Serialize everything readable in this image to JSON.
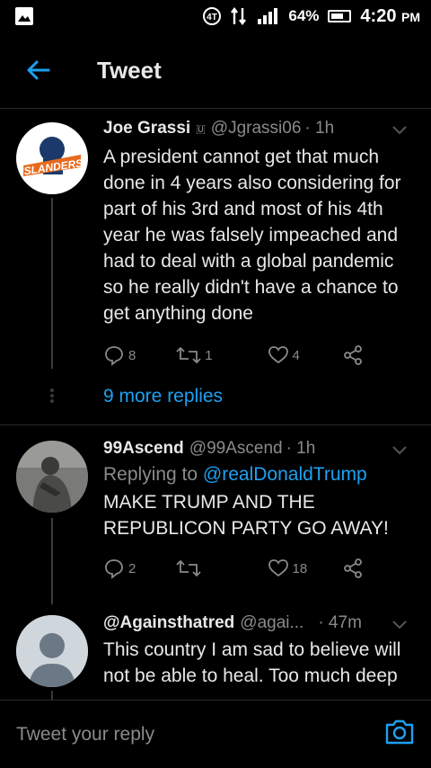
{
  "status_bar": {
    "battery": "64%",
    "time": "4:20",
    "ampm": "PM"
  },
  "app_bar": {
    "title": "Tweet"
  },
  "tweets": [
    {
      "name": "Joe Grassi",
      "badge": "🇺",
      "handle": "@Jgrassi06",
      "time": "· 1h",
      "text": "A president cannot get that much done in 4 years also considering for part of his 3rd and most of his 4th year he was falsely impeached and had to deal with a global pandemic so he really didn't have a chance to get anything done",
      "replies": "8",
      "retweets": "1",
      "likes": "4",
      "more_replies": "9 more replies",
      "avatar_text": "ISLANDERS"
    },
    {
      "name": "99Ascend",
      "handle": "@99Ascend",
      "time": "· 1h",
      "reply_prefix": "Replying to ",
      "reply_to": "@realDonaldTrump",
      "text": "MAKE TRUMP AND THE REPUBLICON PARTY GO AWAY!",
      "replies": "2",
      "retweets": "",
      "likes": "18"
    },
    {
      "name": "@Againsthatred",
      "handle": "@agai...",
      "time": "· 47m",
      "text": "This country I am sad to believe will not be able to heal.  Too much deep"
    }
  ],
  "reply_bar": {
    "placeholder": "Tweet your reply"
  },
  "colors": {
    "accent": "#1da1f2",
    "background": "#000000",
    "muted": "#8a8a8a"
  }
}
